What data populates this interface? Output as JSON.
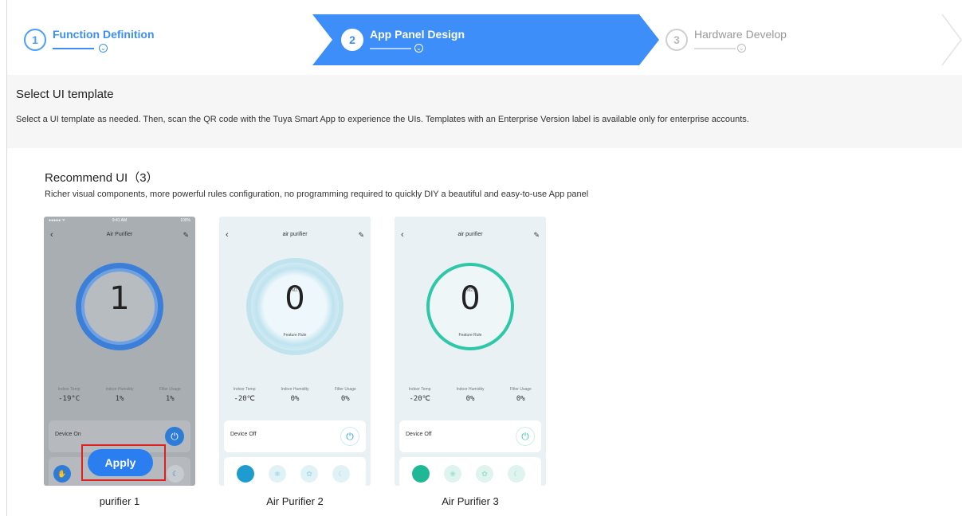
{
  "steps": [
    {
      "number": "1",
      "title": "Function Definition"
    },
    {
      "number": "2",
      "title": "App Panel Design"
    },
    {
      "number": "3",
      "title": "Hardware Develop"
    }
  ],
  "select": {
    "title": "Select UI template",
    "description": "Select a UI template as needed. Then, scan the QR code with the Tuya Smart App to experience the UIs. Templates with an Enterprise Version label is available only for enterprise accounts."
  },
  "recommend": {
    "title": "Recommend UI（3）",
    "description": "Richer visual components, more powerful rules configuration, no programming required to quickly DIY a beautiful and easy-to-use App panel"
  },
  "templates": [
    {
      "caption": "purifier 1",
      "screen_title": "Air Purifier",
      "time": "9:41 AM",
      "battery": "100%",
      "value": "1",
      "stats": [
        {
          "label": "Indoor Temp",
          "value": "-19°C"
        },
        {
          "label": "Indoor Humidity",
          "value": "1%"
        },
        {
          "label": "Filter Usage",
          "value": "1%"
        }
      ],
      "device_label": "Device On"
    },
    {
      "caption": "Air Purifier 2",
      "screen_title": "air purifier",
      "value": "0",
      "top_label": "PM2.5",
      "bottom_label": "Feature Rule",
      "stats": [
        {
          "label": "Indoor Temp",
          "value": "-20℃"
        },
        {
          "label": "Indoor Humidity",
          "value": "0%"
        },
        {
          "label": "Filter Usage",
          "value": "0%"
        }
      ],
      "device_label": "Device Off"
    },
    {
      "caption": "Air Purifier 3",
      "screen_title": "air purifier",
      "value": "0",
      "top_label": "PM2.5",
      "bottom_label": "Feature Rule",
      "stats": [
        {
          "label": "Indoor Temp",
          "value": "-20℃"
        },
        {
          "label": "Indoor Humidity",
          "value": "0%"
        },
        {
          "label": "Filter Usage",
          "value": "0%"
        }
      ],
      "device_label": "Device Off"
    }
  ],
  "apply_label": "Apply",
  "colors": {
    "accent": "#3d8ef8",
    "highlight": "#e02020",
    "teal": "#2ec8a8"
  }
}
